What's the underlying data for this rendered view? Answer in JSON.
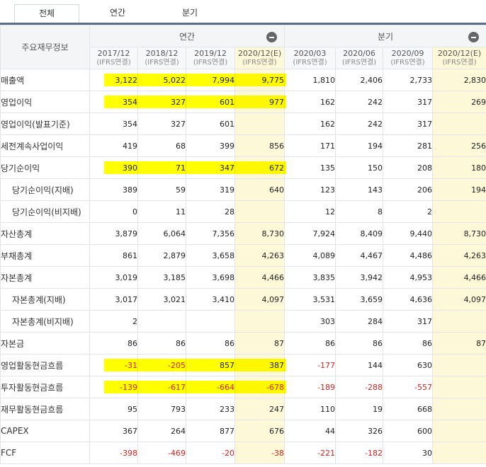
{
  "tabs": [
    "전체",
    "연간",
    "분기"
  ],
  "header": {
    "label": "주요재무정보",
    "annual": "연간",
    "quarterly": "분기",
    "periods": [
      {
        "p": "2017/12",
        "s": "(IFRS연결)",
        "est": false
      },
      {
        "p": "2018/12",
        "s": "(IFRS연결)",
        "est": false
      },
      {
        "p": "2019/12",
        "s": "(IFRS연결)",
        "est": false
      },
      {
        "p": "2020/12(E)",
        "s": "(IFRS연결)",
        "est": true
      },
      {
        "p": "2020/03",
        "s": "(IFRS연결)",
        "est": false
      },
      {
        "p": "2020/06",
        "s": "(IFRS연결)",
        "est": false
      },
      {
        "p": "2020/09",
        "s": "(IFRS연결)",
        "est": false
      },
      {
        "p": "2020/12(E)",
        "s": "(IFRS연결)",
        "est": true
      }
    ]
  },
  "rows": [
    {
      "label": "매출액",
      "indent": false,
      "values": [
        "3,122",
        "5,022",
        "7,994",
        "9,775",
        "1,810",
        "2,406",
        "2,733",
        "2,830"
      ]
    },
    {
      "label": "영업이익",
      "indent": false,
      "values": [
        "354",
        "327",
        "601",
        "977",
        "162",
        "242",
        "317",
        "269"
      ]
    },
    {
      "label": "영업이익(발표기준)",
      "indent": false,
      "values": [
        "354",
        "327",
        "601",
        "",
        "162",
        "242",
        "317",
        ""
      ]
    },
    {
      "label": "세전계속사업이익",
      "indent": false,
      "values": [
        "419",
        "68",
        "399",
        "856",
        "171",
        "194",
        "281",
        "256"
      ]
    },
    {
      "label": "당기순이익",
      "indent": false,
      "values": [
        "390",
        "71",
        "347",
        "672",
        "135",
        "150",
        "208",
        "180"
      ]
    },
    {
      "label": "당기순이익(지배)",
      "indent": true,
      "values": [
        "389",
        "59",
        "319",
        "640",
        "123",
        "143",
        "206",
        "194"
      ]
    },
    {
      "label": "당기순이익(비지배)",
      "indent": true,
      "values": [
        "0",
        "11",
        "28",
        "",
        "12",
        "8",
        "2",
        ""
      ]
    },
    {
      "label": "자산총계",
      "indent": false,
      "values": [
        "3,879",
        "6,064",
        "7,356",
        "8,730",
        "7,924",
        "8,409",
        "9,440",
        "8,730"
      ]
    },
    {
      "label": "부채총계",
      "indent": false,
      "values": [
        "861",
        "2,879",
        "3,658",
        "4,263",
        "4,089",
        "4,467",
        "4,486",
        "4,263"
      ]
    },
    {
      "label": "자본총계",
      "indent": false,
      "values": [
        "3,019",
        "3,185",
        "3,698",
        "4,466",
        "3,835",
        "3,942",
        "4,953",
        "4,466"
      ]
    },
    {
      "label": "자본총계(지배)",
      "indent": true,
      "values": [
        "3,017",
        "3,021",
        "3,410",
        "4,097",
        "3,531",
        "3,659",
        "4,636",
        "4,097"
      ]
    },
    {
      "label": "자본총계(비지배)",
      "indent": true,
      "values": [
        "2",
        "",
        "",
        "",
        "303",
        "284",
        "317",
        ""
      ]
    },
    {
      "label": "자본금",
      "indent": false,
      "values": [
        "86",
        "86",
        "86",
        "87",
        "86",
        "86",
        "86",
        "87"
      ]
    },
    {
      "label": "영업활동현금흐름",
      "indent": false,
      "values": [
        "-31",
        "-205",
        "857",
        "387",
        "-177",
        "144",
        "630",
        ""
      ]
    },
    {
      "label": "투자활동현금흐름",
      "indent": false,
      "values": [
        "-139",
        "-617",
        "-664",
        "-678",
        "-189",
        "-288",
        "-557",
        ""
      ]
    },
    {
      "label": "재무활동현금흐름",
      "indent": false,
      "values": [
        "95",
        "793",
        "233",
        "247",
        "110",
        "19",
        "668",
        ""
      ]
    },
    {
      "label": "CAPEX",
      "indent": false,
      "values": [
        "367",
        "264",
        "877",
        "676",
        "44",
        "326",
        "600",
        ""
      ]
    },
    {
      "label": "FCF",
      "indent": false,
      "values": [
        "-398",
        "-469",
        "-20",
        "-38",
        "-221",
        "-182",
        "30",
        ""
      ]
    }
  ],
  "highlight_rows": [
    0,
    1,
    4,
    13,
    14
  ],
  "colors": {
    "highlight": "#ffff00",
    "estimate": "#fdf8d8",
    "negative": "#e02020"
  }
}
